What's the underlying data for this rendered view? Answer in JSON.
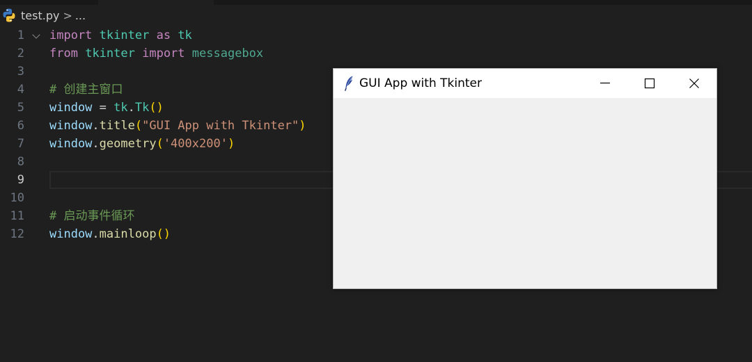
{
  "breadcrumb": {
    "file": "test.py",
    "separator": ">",
    "more": "..."
  },
  "editor": {
    "active_line": "9",
    "lines": [
      {
        "num": "1",
        "tokens": [
          [
            "import",
            "kw"
          ],
          [
            " ",
            "op"
          ],
          [
            "tkinter",
            "mod"
          ],
          [
            " ",
            "op"
          ],
          [
            "as",
            "kw"
          ],
          [
            " ",
            "op"
          ],
          [
            "tk",
            "mod"
          ]
        ]
      },
      {
        "num": "2",
        "tokens": [
          [
            "from",
            "kw"
          ],
          [
            " ",
            "op"
          ],
          [
            "tkinter",
            "mod"
          ],
          [
            " ",
            "op"
          ],
          [
            "import",
            "kw"
          ],
          [
            " ",
            "op"
          ],
          [
            "messagebox",
            "mod2"
          ]
        ]
      },
      {
        "num": "3",
        "tokens": []
      },
      {
        "num": "4",
        "tokens": [
          [
            "# 创建主窗口",
            "cm"
          ]
        ]
      },
      {
        "num": "5",
        "tokens": [
          [
            "window",
            "var"
          ],
          [
            " = ",
            "op"
          ],
          [
            "tk",
            "mod"
          ],
          [
            ".",
            "op"
          ],
          [
            "Tk",
            "mod"
          ],
          [
            "()",
            "br"
          ]
        ]
      },
      {
        "num": "6",
        "tokens": [
          [
            "window",
            "var"
          ],
          [
            ".",
            "op"
          ],
          [
            "title",
            "fn"
          ],
          [
            "(",
            "br"
          ],
          [
            "\"GUI App with Tkinter\"",
            "str"
          ],
          [
            ")",
            "br"
          ]
        ]
      },
      {
        "num": "7",
        "tokens": [
          [
            "window",
            "var"
          ],
          [
            ".",
            "op"
          ],
          [
            "geometry",
            "fn"
          ],
          [
            "(",
            "br"
          ],
          [
            "'400x200'",
            "str"
          ],
          [
            ")",
            "br"
          ]
        ]
      },
      {
        "num": "8",
        "tokens": []
      },
      {
        "num": "9",
        "tokens": []
      },
      {
        "num": "10",
        "tokens": []
      },
      {
        "num": "11",
        "tokens": [
          [
            "# 启动事件循环",
            "cm"
          ]
        ]
      },
      {
        "num": "12",
        "tokens": [
          [
            "window",
            "var"
          ],
          [
            ".",
            "op"
          ],
          [
            "mainloop",
            "fn"
          ],
          [
            "()",
            "br"
          ]
        ]
      }
    ]
  },
  "tk_window": {
    "title": "GUI App with Tkinter",
    "icon": "feather-icon",
    "controls": [
      "minimize-icon",
      "maximize-icon",
      "close-icon"
    ]
  }
}
